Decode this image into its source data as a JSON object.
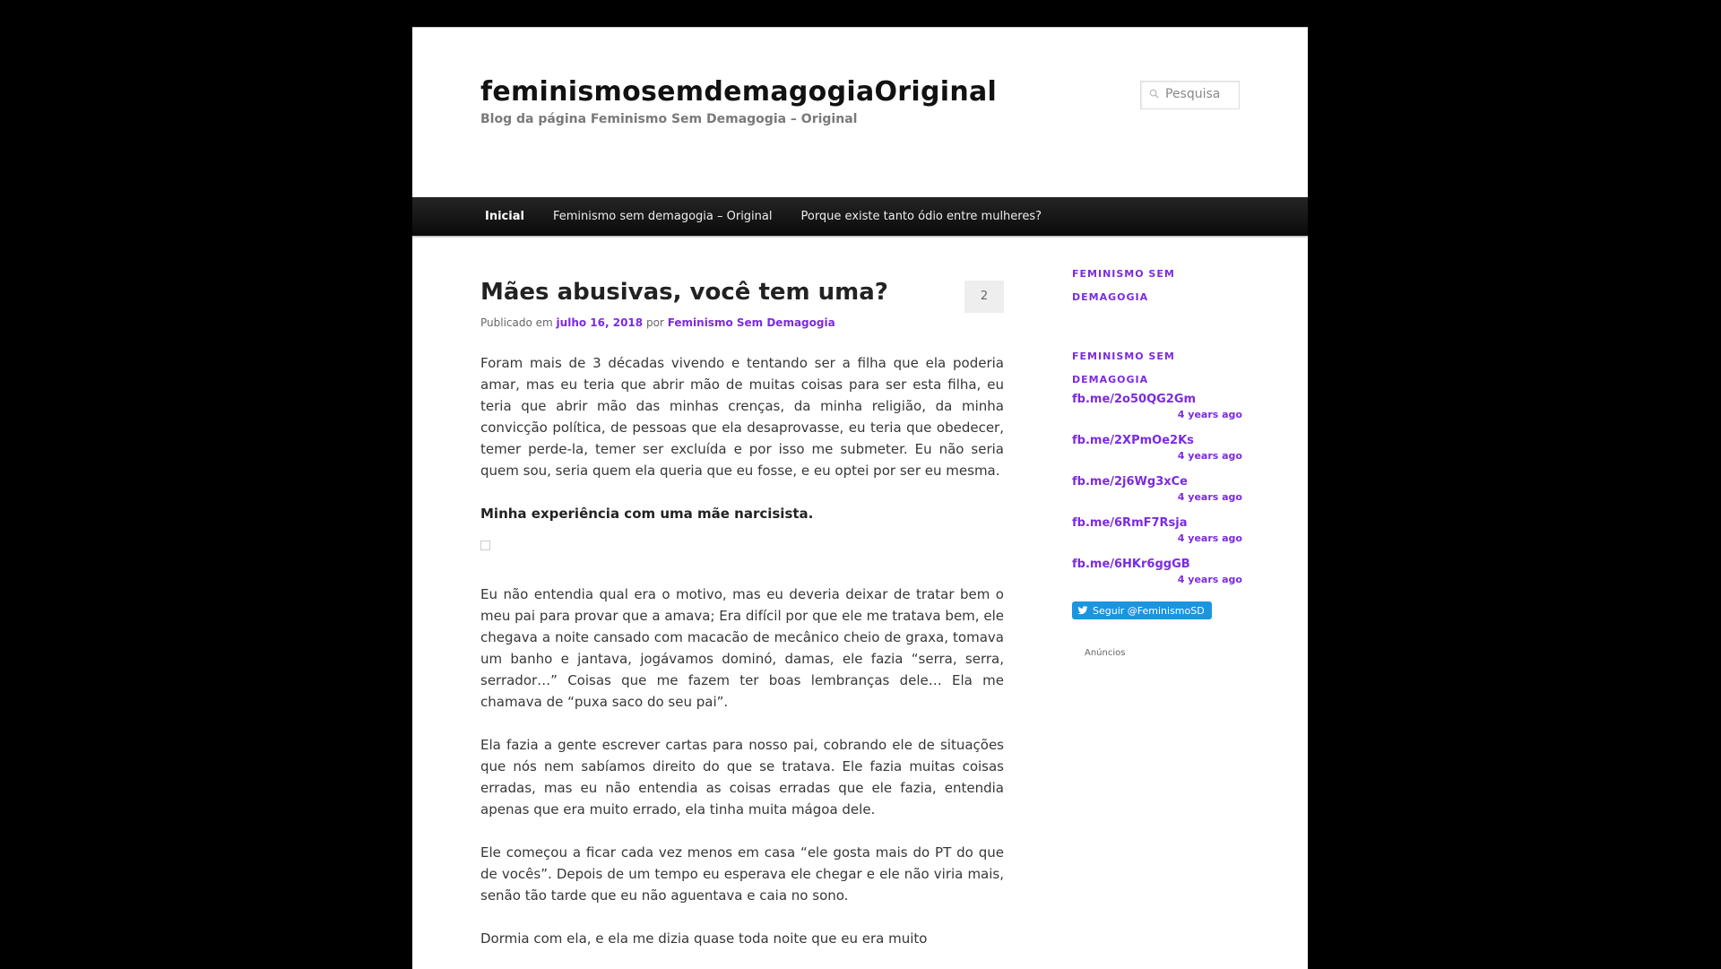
{
  "site": {
    "title": "feminismosemdemagogiaOriginal",
    "description": "Blog da página Feminismo Sem Demagogia – Original"
  },
  "search": {
    "placeholder": "Pesquisa"
  },
  "nav": {
    "items": [
      {
        "label": "Inicial",
        "current": true
      },
      {
        "label": "Feminismo sem demagogia – Original",
        "current": false
      },
      {
        "label": "Porque existe tanto ódio entre mulheres?",
        "current": false
      }
    ]
  },
  "post": {
    "title": "Mães abusivas, você tem uma?",
    "comments_count": "2",
    "meta": {
      "published_prefix": "Publicado em",
      "date": "julho 16, 2018",
      "by": "por",
      "author": "Feminismo Sem Demagogia"
    },
    "paragraphs": [
      "Foram mais de 3 décadas vivendo e tentando ser a filha que ela poderia amar, mas eu teria que abrir mão de muitas coisas para ser esta filha, eu teria que abrir mão das minhas crenças, da minha religião, da minha convicção política, de pessoas que ela desaprovasse, eu teria que obedecer, temer perde-la, temer ser excluída e por isso me submeter. Eu não seria quem sou, seria quem ela queria que eu fosse, e eu optei por ser eu mesma.",
      "Minha experiência com uma mãe narcisista.",
      "Eu não entendia qual era o motivo, mas eu deveria deixar de tratar bem o meu pai para provar que a amava; Era difícil por que ele me tratava bem, ele chegava a noite cansado com macacão de mecânico cheio de graxa, tomava um banho e jantava, jogávamos dominó, damas, ele fazia “serra, serra, serrador…” Coisas que me fazem ter boas lembranças dele… Ela me chamava de “puxa saco do seu pai”.",
      "Ela fazia a gente escrever cartas para nosso pai, cobrando ele de situações que nós nem sabíamos direito do que se tratava. Ele fazia muitas coisas erradas, mas eu não entendia as coisas erradas que ele fazia, entendia apenas que era muito errado, ela tinha muita mágoa dele.",
      "Ele começou a ficar cada vez menos em casa “ele gosta mais do PT do que de vocês”. Depois de um tempo eu esperava ele chegar e ele não viria mais, senão tão tarde que eu não aguentava e caia no sono.",
      "Dormia com ela, e ela me dizia quase toda noite que eu era muito"
    ]
  },
  "sidebar": {
    "widget1_title": "Feminismo sem demagogia",
    "widget2_title": "Feminismo sem demagogia",
    "tweets": [
      {
        "link": "fb.me/2o50QG2Gm",
        "time": "4 years ago"
      },
      {
        "link": "fb.me/2XPmOe2Ks",
        "time": "4 years ago"
      },
      {
        "link": "fb.me/2j6Wg3xCe",
        "time": "4 years ago"
      },
      {
        "link": "fb.me/6RmF7Rsja",
        "time": "4 years ago"
      },
      {
        "link": "fb.me/6HKr6ggGB",
        "time": "4 years ago"
      }
    ],
    "follow_label": "Seguir @FeminismoSD",
    "ads_label": "Anúncios"
  },
  "colors": {
    "accent": "#7c2be0",
    "nav_bg": "#1a1a1a",
    "page_bg": "#000000",
    "twitter_blue": "#1b95e0"
  },
  "icons": {
    "search": "search-icon",
    "twitter": "twitter-bird-icon"
  }
}
